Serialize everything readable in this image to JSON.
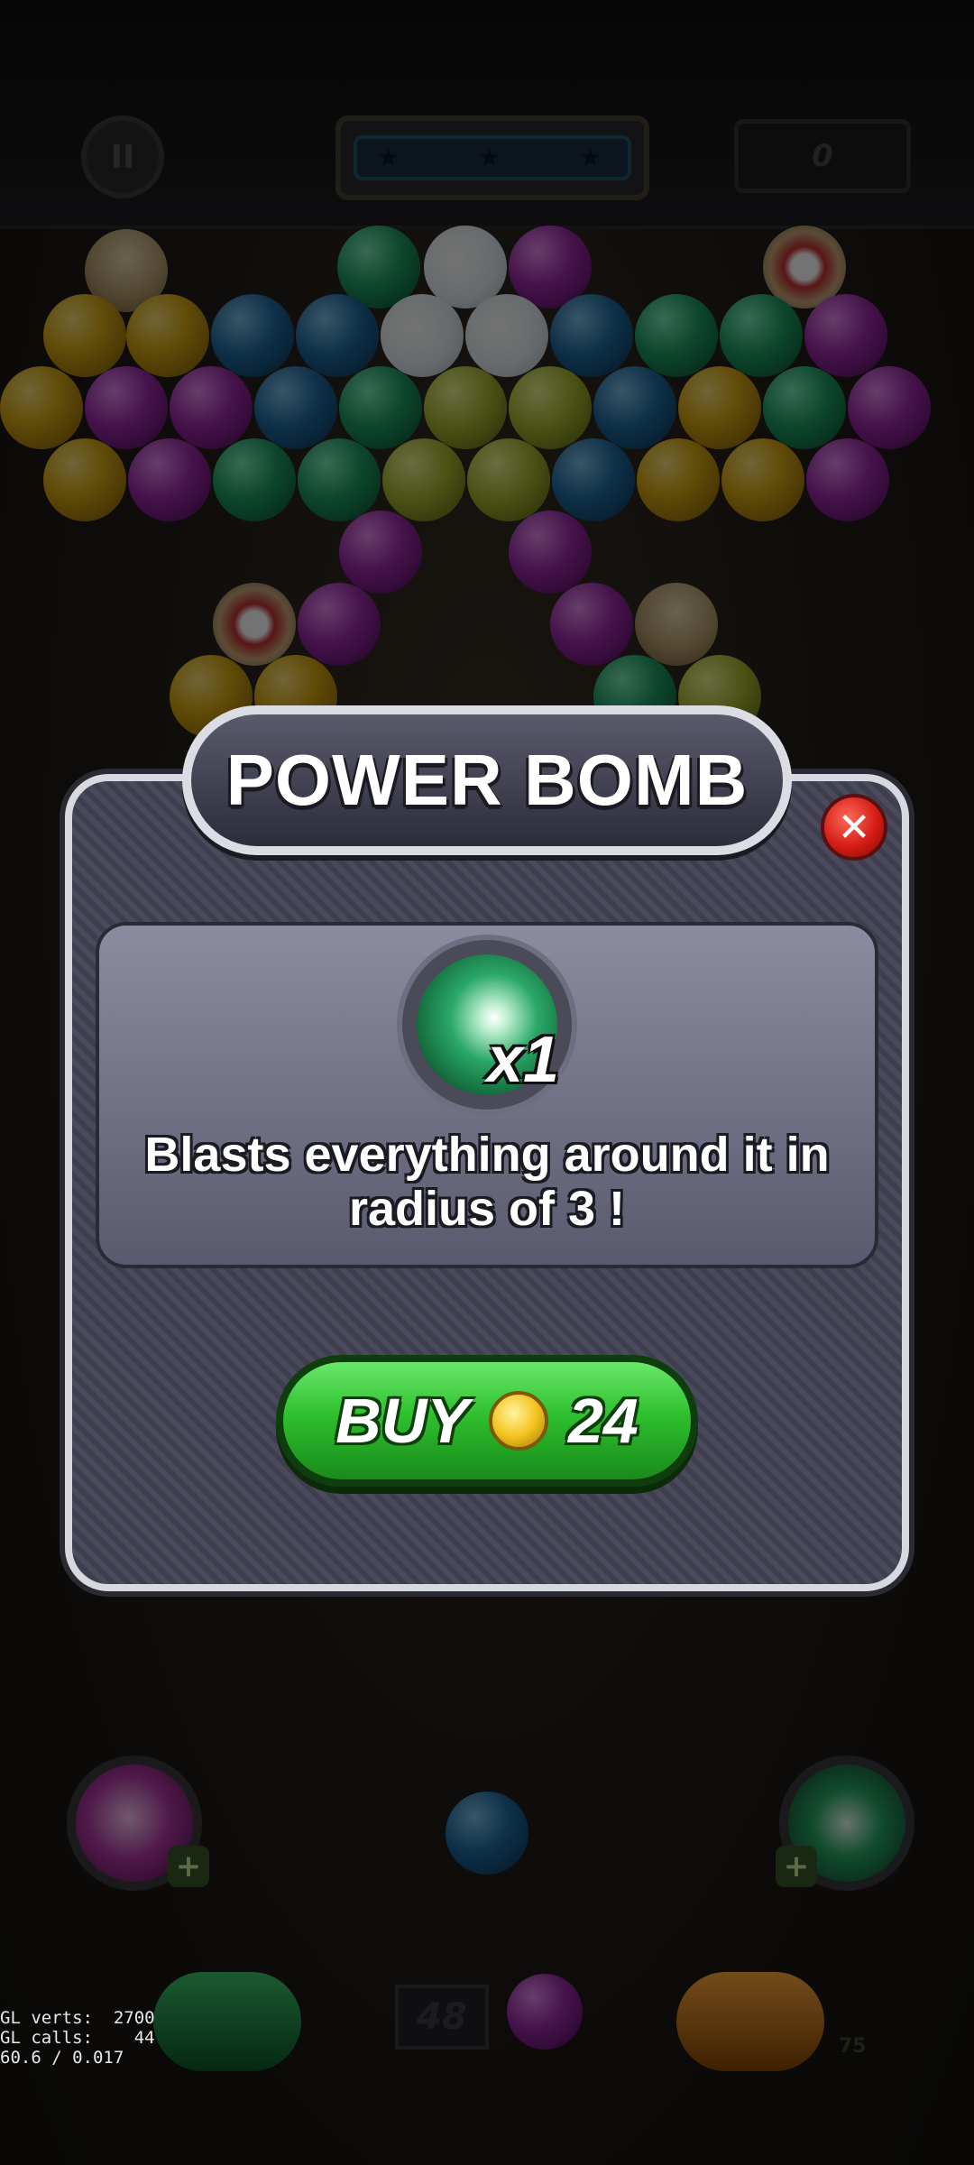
{
  "hud": {
    "pause_icon": "pause-icon",
    "score": "0",
    "progress_stars": 3
  },
  "dialog": {
    "title": "POWER BOMB",
    "close_icon": "close-x-icon",
    "item": {
      "icon": "power-bomb-orb-icon",
      "quantity": "x1"
    },
    "description": "Blasts everything around it in radius of 3 !",
    "buy_button": {
      "label": "BUY",
      "coin_icon": "gold-coin-icon",
      "price": "24"
    }
  },
  "bottom": {
    "shot_counter": "48",
    "right_booster_count": "75"
  },
  "debug_overlay": {
    "line1": "GL verts:  2700",
    "line2": "GL calls:    44",
    "line3": "60.6 / 0.017"
  },
  "colors": {
    "dialog_border": "#d8d8e0",
    "buy_green": "#2ec02e",
    "close_red": "#d41c14"
  }
}
